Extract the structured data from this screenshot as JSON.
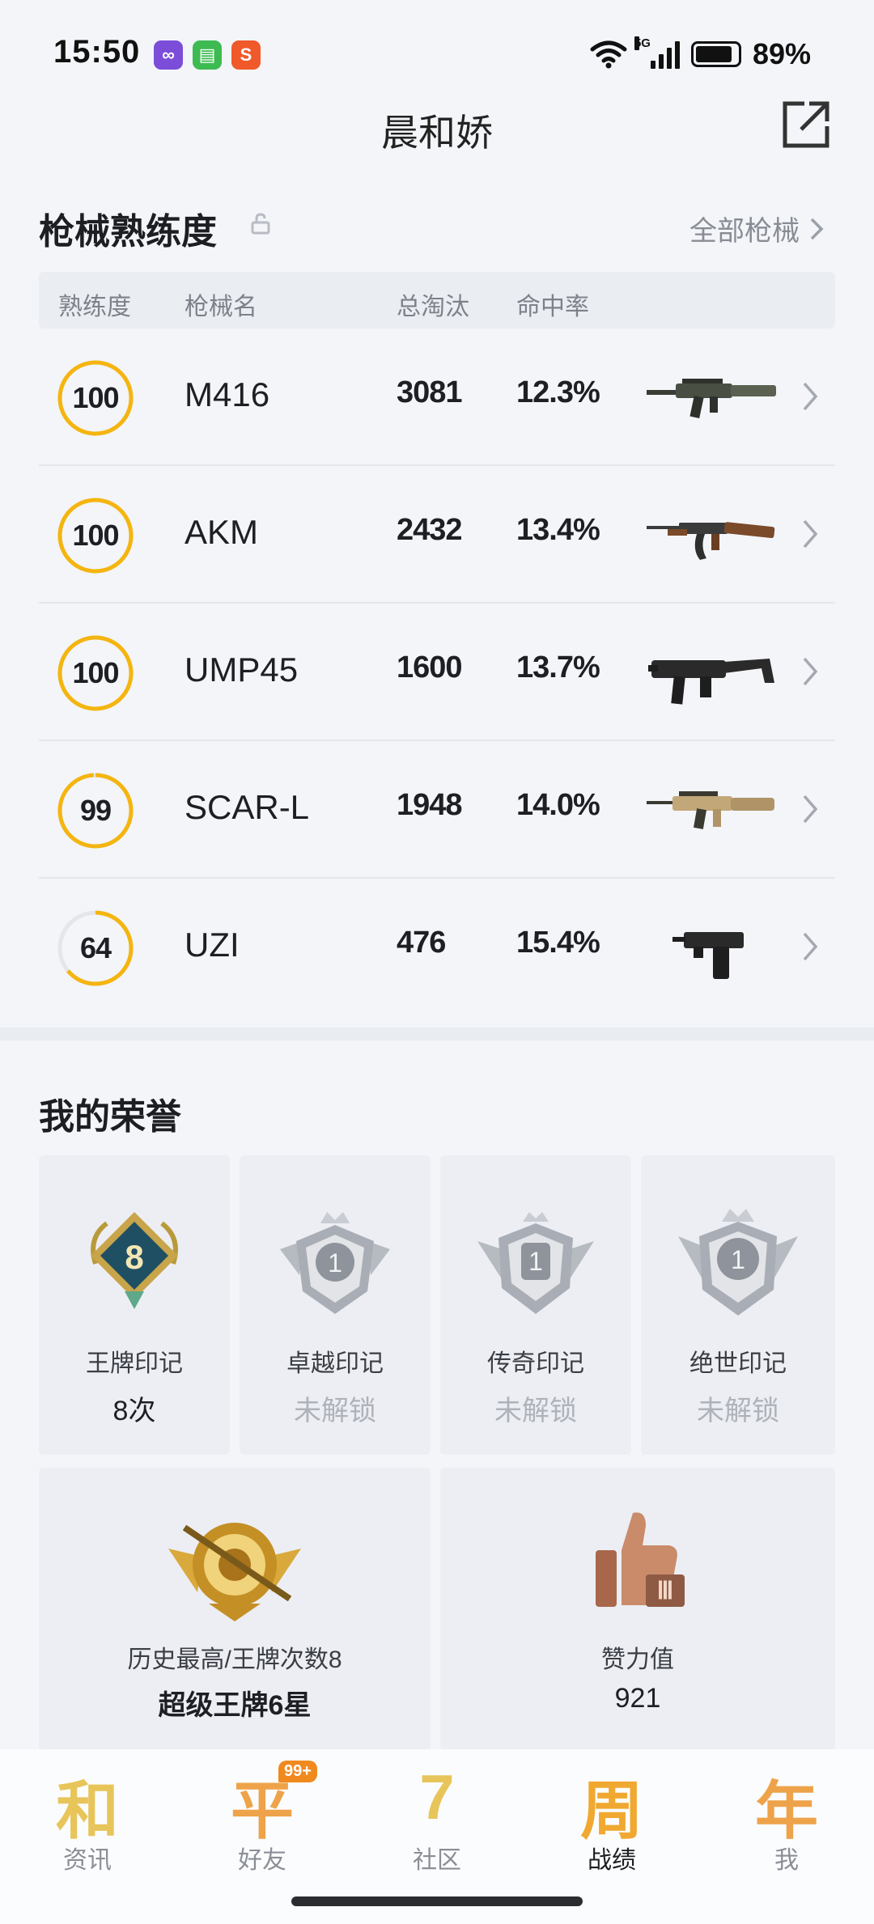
{
  "status_bar": {
    "time": "15:50",
    "apps": [
      {
        "icon": "infinity-app-icon",
        "color": "#7b4dd8",
        "glyph": "∞"
      },
      {
        "icon": "chat-app-icon",
        "color": "#3dbb52",
        "glyph": "▤"
      },
      {
        "icon": "sogou-app-icon",
        "color": "#f0592a",
        "glyph": "S"
      }
    ],
    "network": "5G",
    "battery_level": 0.89,
    "battery": "89%"
  },
  "header": {
    "title": "晨和娇"
  },
  "weapons": {
    "title": "枪械熟练度",
    "all_link": "全部枪械",
    "columns": [
      "熟练度",
      "枪械名",
      "总淘汰",
      "命中率"
    ],
    "accent_color": "#f5b50f",
    "rows": [
      {
        "proficiency": "100",
        "name": "M416",
        "kills": "3081",
        "hit_rate": "12.3%",
        "image": "m416-rifle-icon"
      },
      {
        "proficiency": "100",
        "name": "AKM",
        "kills": "2432",
        "hit_rate": "13.4%",
        "image": "akm-rifle-icon"
      },
      {
        "proficiency": "100",
        "name": "UMP45",
        "kills": "1600",
        "hit_rate": "13.7%",
        "image": "ump45-smg-icon"
      },
      {
        "proficiency": "99",
        "name": "SCAR-L",
        "kills": "1948",
        "hit_rate": "14.0%",
        "image": "scar-l-rifle-icon"
      },
      {
        "proficiency": "64",
        "name": "UZI",
        "kills": "476",
        "hit_rate": "15.4%",
        "image": "uzi-smg-icon"
      }
    ]
  },
  "honors": {
    "title": "我的荣誉",
    "marks": [
      {
        "label": "王牌印记",
        "value": "8次",
        "badge": "8",
        "locked": false
      },
      {
        "label": "卓越印记",
        "value": "未解锁",
        "badge": "1",
        "locked": true
      },
      {
        "label": "传奇印记",
        "value": "未解锁",
        "badge": "1",
        "locked": true
      },
      {
        "label": "绝世印记",
        "value": "未解锁",
        "badge": "1",
        "locked": true
      }
    ],
    "history": {
      "label": "历史最高/王牌次数8",
      "value": "超级王牌6星"
    },
    "likes": {
      "label": "赞力值",
      "value": "921",
      "badge": "Ⅲ"
    }
  },
  "bottom_nav": {
    "items": [
      {
        "glyph": "和",
        "label": "资讯",
        "color": "#e8c55a"
      },
      {
        "glyph": "平",
        "label": "好友",
        "color": "#eea34a",
        "badge": "99+"
      },
      {
        "glyph": "7",
        "label": "社区",
        "color": "#e8c55a"
      },
      {
        "glyph": "周",
        "label": "战绩",
        "color": "#f0a830",
        "active": true
      },
      {
        "glyph": "年",
        "label": "我",
        "color": "#eea34a"
      }
    ]
  }
}
